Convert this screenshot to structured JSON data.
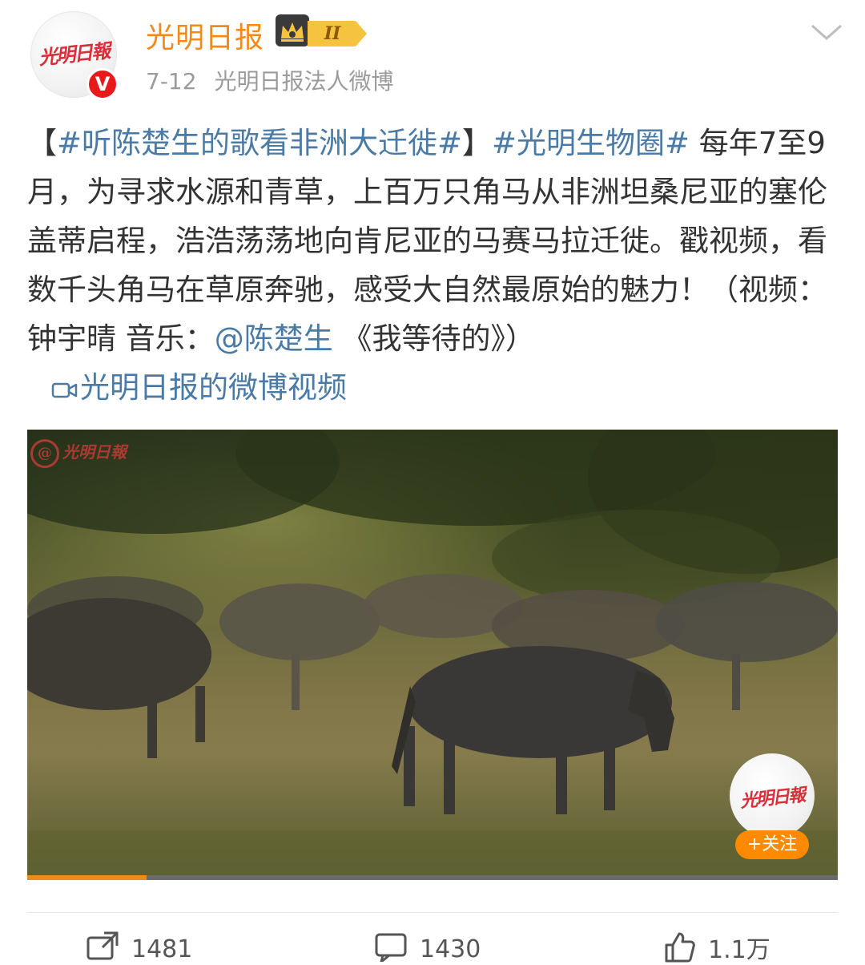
{
  "author": {
    "name": "光明日报",
    "avatar_text": "光明日報",
    "verified_mark": "V",
    "level_badge": "II",
    "date": "7-12",
    "source": "光明日报法人微博"
  },
  "post": {
    "tag1": "#听陈楚生的歌看非洲大迁徙#",
    "bracket_open": "【",
    "bracket_close": "】",
    "tag2": "#光明生物圈#",
    "text": " 每年7至9月，为寻求水源和青草，上百万只角马从非洲坦桑尼亚的塞伦盖蒂启程，浩浩荡荡地向肯尼亚的马赛马拉迁徙。戳视频，看数千头角马在草原奔驰，感受大自然最原始的魅力！（视频：钟宇晴 音乐：",
    "mention": "@陈楚生",
    "text_after": " 《我等待的》）",
    "video_link": "光明日报的微博视频"
  },
  "video": {
    "watermark": "光明日報",
    "overlay_avatar_text": "光明日報",
    "follow_label": "+关注",
    "progress": 0.147
  },
  "actions": {
    "repost_count": "1481",
    "comment_count": "1430",
    "like_count": "1.1万"
  },
  "colors": {
    "accent_orange": "#f08a1a",
    "link_blue": "#4a7aa6",
    "verified_red": "#e8191a"
  }
}
